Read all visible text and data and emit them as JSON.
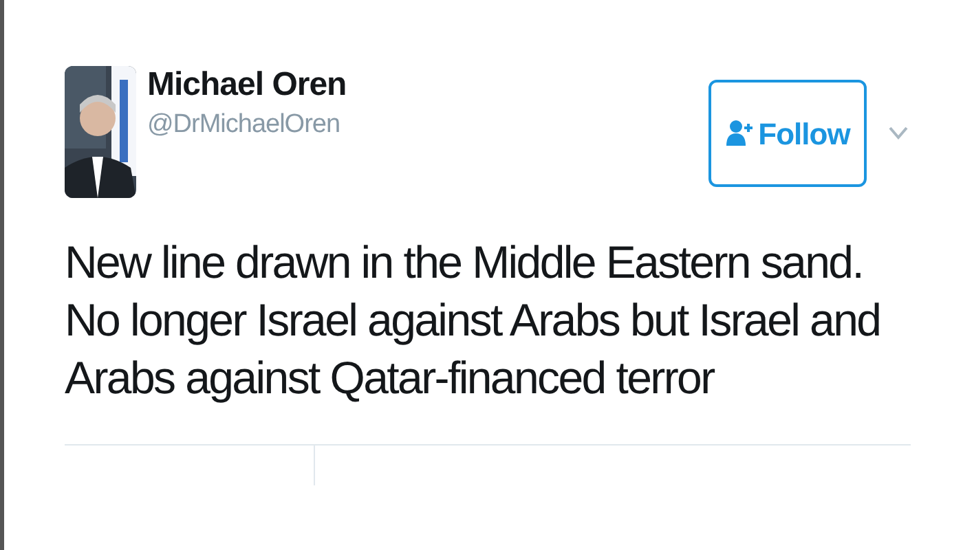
{
  "author": {
    "name": "Michael Oren",
    "handle": "@DrMichaelOren"
  },
  "follow_button": {
    "label": "Follow"
  },
  "text": "New line drawn in the Middle Eastern sand. No longer Israel against Arabs but Israel and Arabs against Qatar-financed terror"
}
